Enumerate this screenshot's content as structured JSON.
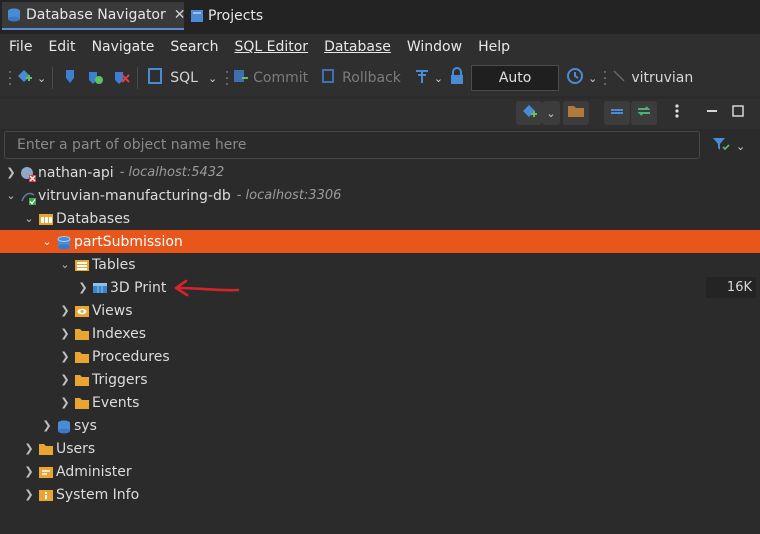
{
  "menu": {
    "items": [
      {
        "label": "File"
      },
      {
        "label": "Edit"
      },
      {
        "label": "Navigate"
      },
      {
        "label": "Search"
      },
      {
        "label": "SQL Editor"
      },
      {
        "label": "Database"
      },
      {
        "label": "Window"
      },
      {
        "label": "Help"
      }
    ]
  },
  "toolbar": {
    "sql_label": "SQL",
    "commit_label": "Commit",
    "rollback_label": "Rollback",
    "transaction_mode": "Auto",
    "active_connection": "vitruvian"
  },
  "tabs": {
    "navigator_label": "Database Navigator",
    "navigator_close": "✕",
    "projects_label": "Projects"
  },
  "search": {
    "placeholder": "Enter a part of object name here"
  },
  "tree": {
    "conn1_name": "nathan-api",
    "conn1_host": "- localhost:5432",
    "conn2_name": "vitruvian-manufacturing-db",
    "conn2_host": "- localhost:3306",
    "databases_label": "Databases",
    "schema_label": "partSubmission",
    "tables_label": "Tables",
    "table_name": "3D Print",
    "table_size": "16K",
    "views_label": "Views",
    "indexes_label": "Indexes",
    "procedures_label": "Procedures",
    "triggers_label": "Triggers",
    "events_label": "Events",
    "sys_label": "sys",
    "users_label": "Users",
    "administer_label": "Administer",
    "system_info_label": "System Info"
  },
  "colors": {
    "selection": "#e8561c",
    "annotation_arrow": "#d6252a",
    "folder": "#e9a431",
    "accent_blue": "#5a8bd1"
  }
}
